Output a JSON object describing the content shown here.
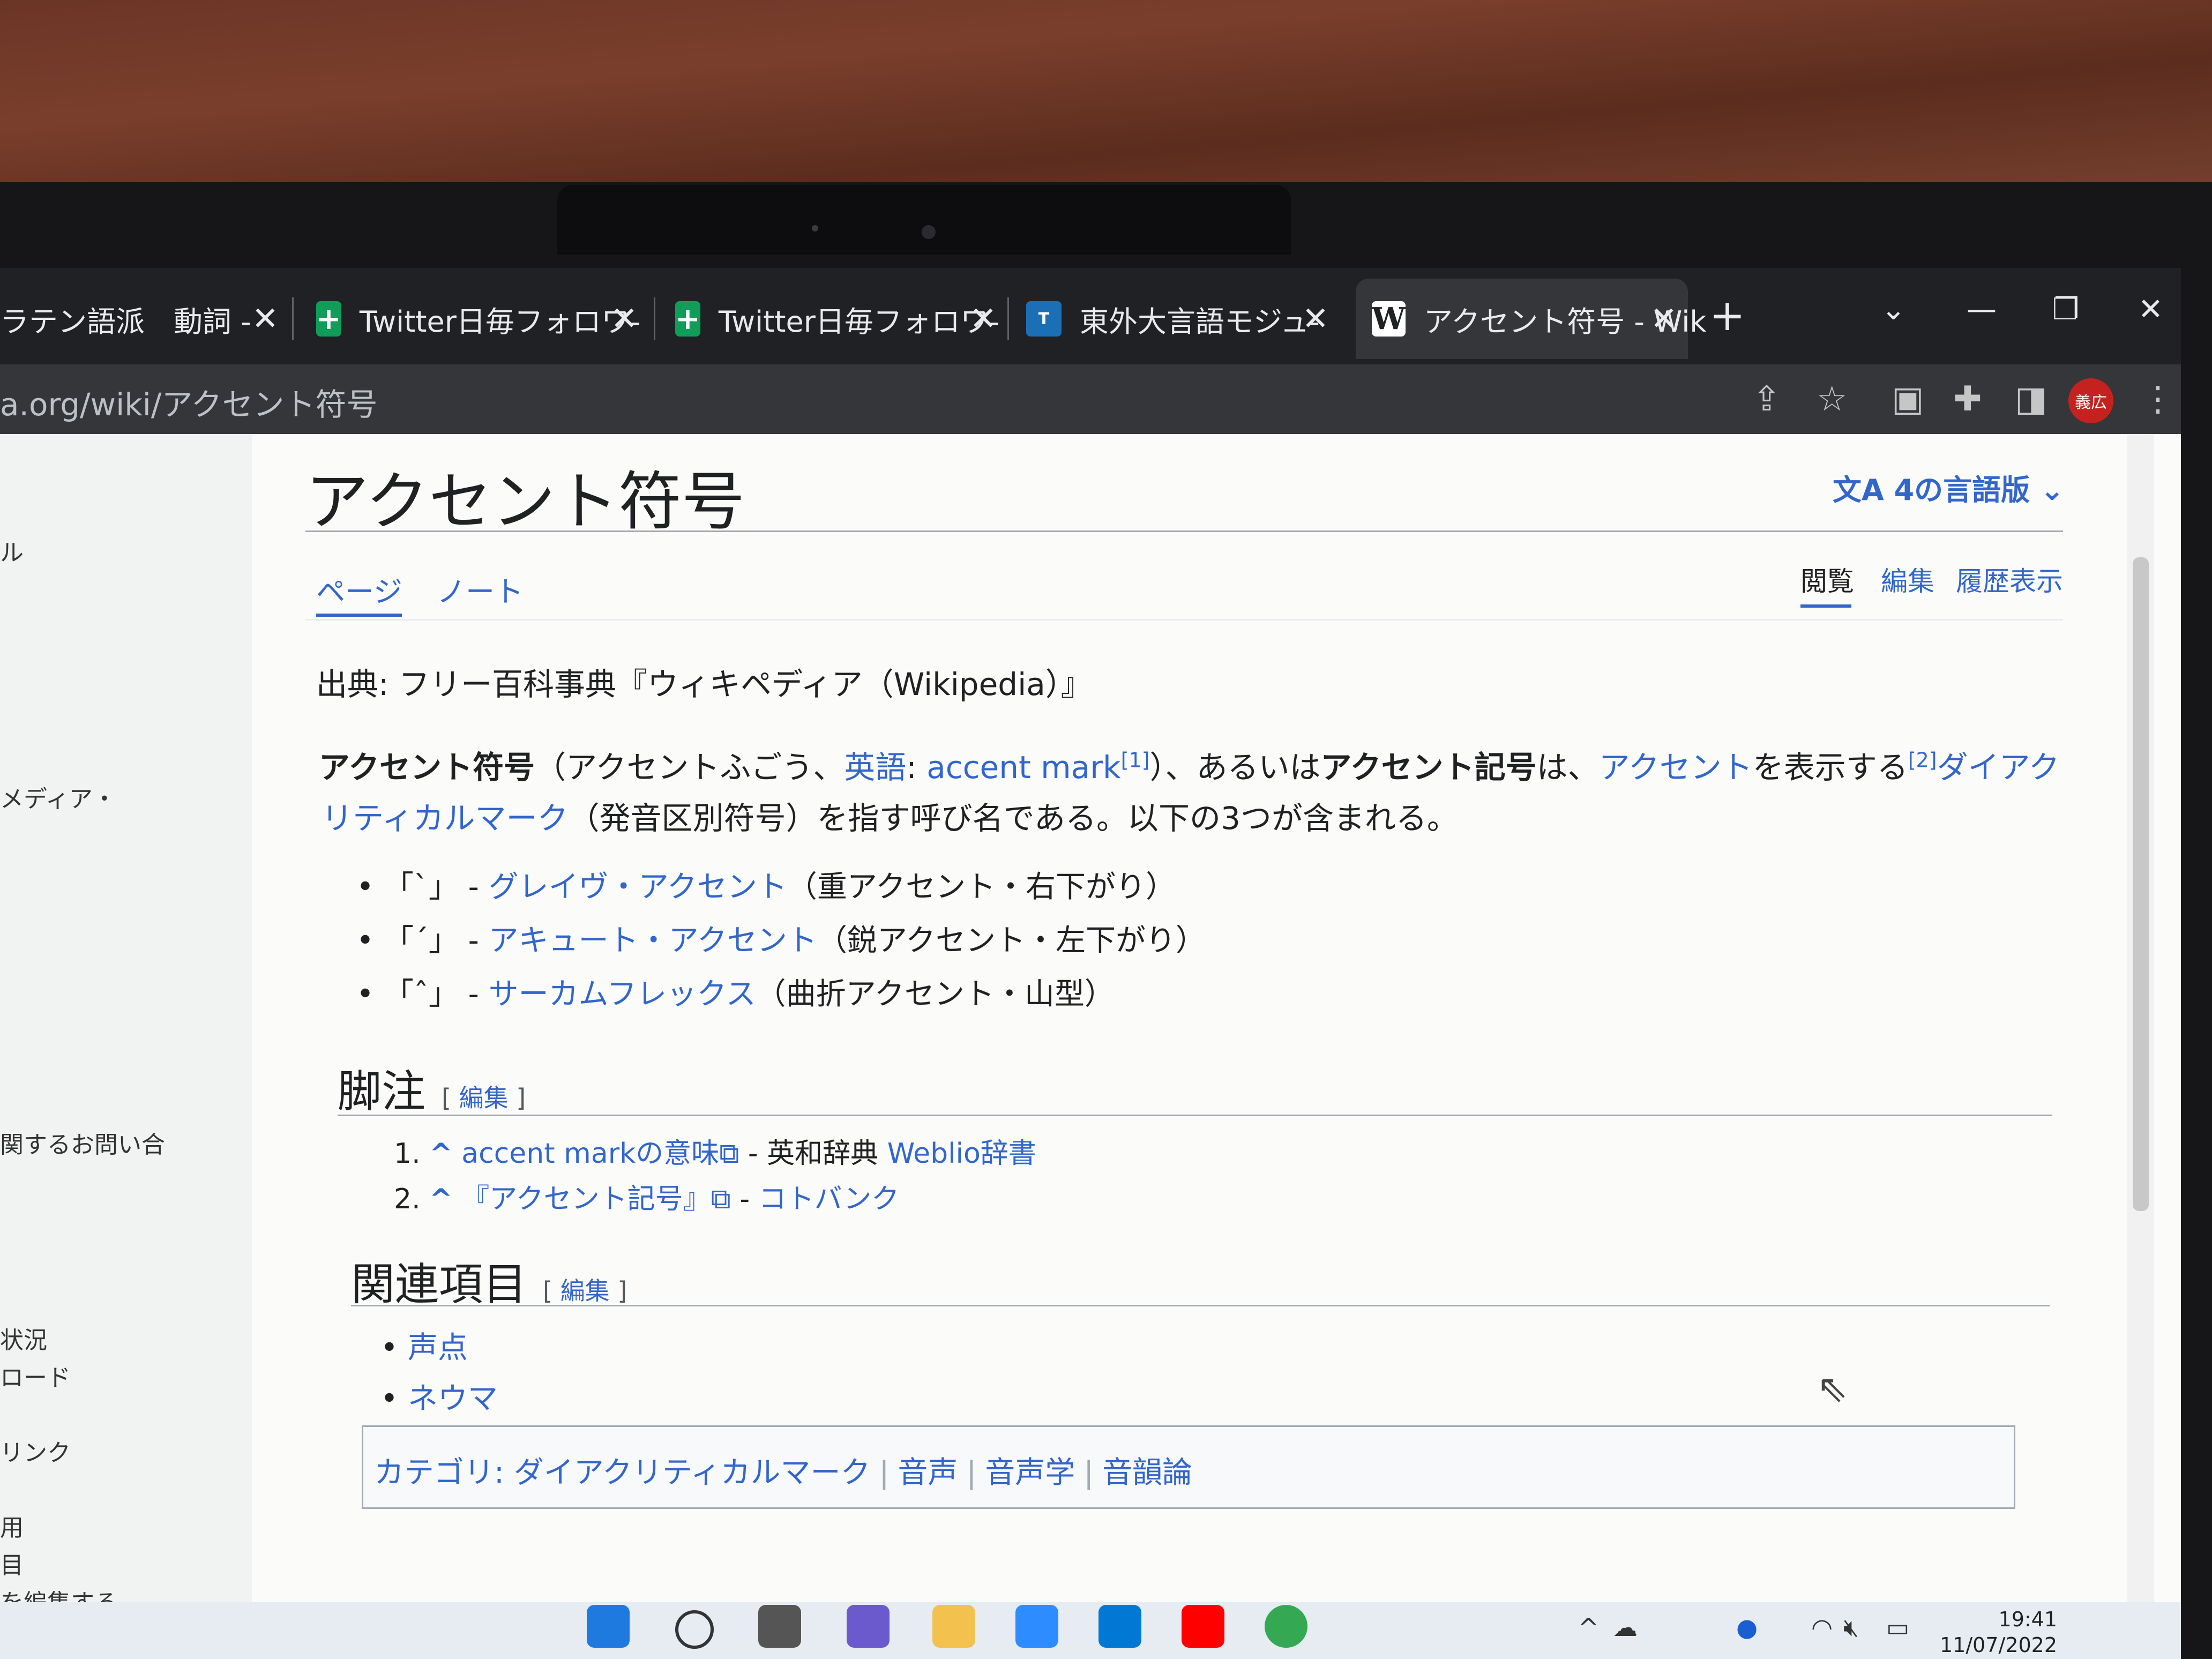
{
  "browser": {
    "tabs": [
      {
        "title": "ラテン語派　動詞 -",
        "close": "✕"
      },
      {
        "title": "Twitter日毎フォロワ-",
        "close": "✕"
      },
      {
        "title": "Twitter日毎フォロワ-",
        "close": "✕"
      },
      {
        "title": "東外大言語モジュ-",
        "close": "✕"
      },
      {
        "title": "アクセント符号 - Wik",
        "close": "✕",
        "active": true
      }
    ],
    "new_tab": "+",
    "url": "a.org/wiki/アクセント符号",
    "avatar_label": "義広",
    "window_controls": {
      "tab_search": "⌄",
      "minimize": "—",
      "restore": "❐",
      "close": "✕"
    }
  },
  "sidebar": {
    "items": [
      "ル",
      "メディア・",
      "関するお問い合",
      "状況",
      "ロード",
      "リンク",
      "用",
      "目",
      "を編集する"
    ]
  },
  "article": {
    "title": "アクセント符号",
    "languages": "4の言語版",
    "tabs_left": [
      "ページ",
      "ノート"
    ],
    "tabs_right": [
      "閲覧",
      "編集",
      "履歴表示"
    ],
    "source": "出典: フリー百科事典『ウィキペディア（Wikipedia）』",
    "lead": {
      "term": "アクセント符号",
      "paren_open": "（アクセントふごう、",
      "lang_link": "英語",
      "colon": ": ",
      "en_term": "accent mark",
      "ref1": "[1]",
      "mid": "）、あるいは",
      "term2": "アクセント記号",
      "wa": "は、",
      "accent_link": "アクセント",
      "display": "を表示する",
      "ref2": "[2]",
      "diacritic_a": "ダイアク",
      "diacritic_b": "リティカルマーク",
      "rest": "（発音区別符号）を指す呼び名である。以下の3つが含まれる。"
    },
    "list": [
      {
        "mark": "「`」 - ",
        "link": "グレイヴ・アクセント",
        "note": "（重アクセント・右下がり）"
      },
      {
        "mark": "「´」 - ",
        "link": "アキュート・アクセント",
        "note": "（鋭アクセント・左下がり）"
      },
      {
        "mark": "「ˆ」 - ",
        "link": "サーカムフレックス",
        "note": "（曲折アクセント・山型）"
      }
    ],
    "footnotes_heading": "脚注",
    "edit_label": "編集",
    "footnotes": [
      {
        "num": "1.",
        "caret": "^",
        "link": "accent markの意味",
        "rest": " - 英和辞典 ",
        "link2": "Weblio辞書"
      },
      {
        "num": "2.",
        "caret": "^",
        "link": "『アクセント記号』",
        "rest": " - ",
        "link2": "コトバンク"
      }
    ],
    "related_heading": "関連項目",
    "related": [
      "声点",
      "ネウマ"
    ],
    "categories_label": "カテゴリ:",
    "categories": [
      "ダイアクリティカルマーク",
      "音声",
      "音声学",
      "音韻論"
    ]
  },
  "taskbar": {
    "time": "19:41",
    "date": "11/07/2022"
  },
  "colors": {
    "link": "#3366cc",
    "tab_bg": "#202124",
    "avatar": "#c5221f"
  }
}
